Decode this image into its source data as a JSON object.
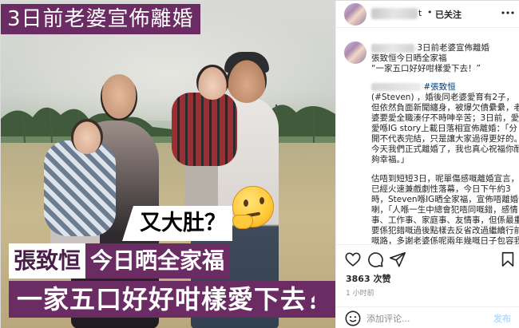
{
  "image": {
    "headline": "3日前老婆宣佈離婚",
    "question": "又大肚？",
    "emoji_icon": "thinking-face-emoji",
    "caption_name": "張致恒",
    "caption_highlight": "今日晒全家福",
    "caption_line2": "一家五口好好咁樣愛下去！",
    "quote_mark": "”",
    "colors": {
      "banner": "#6b2b63",
      "highlight_text": "#ffffff"
    }
  },
  "header": {
    "username_visible_tail": "t",
    "separator": "•",
    "follow_label": "已关注",
    "more_icon": "more-options-icon"
  },
  "caption": {
    "title_text": "3日前老婆宣佈離婚",
    "line2": "張致恒今日晒全家福",
    "line3": "“一家五口好好咁樣愛下去！”",
    "hashtag": "#張致恒",
    "body_lines": [
      "(#Steven) ，婚後同老婆愛育有2子，",
      "但依然負面新聞纏身，被爆欠債纍纍，老",
      "婆要愛全職湊仔不時呻辛苦；3日前，愛",
      "愛喺IG story上載日落相宣佈離婚：「分",
      "開不代表完結，只是讓大家過得更好的。",
      "今天我們正式離婚了，我也真心祝福你耐",
      "夠幸福。」"
    ],
    "body2_lines": [
      "估唔到短短3日，呢單傷感嘅離婚宣言，",
      "已經火速兼戲劇性落幕，今日下午約3",
      "時，Steven喺IG晒全家福，宣佈唔離婚",
      "喇，「人喺一生中總會犯唔同嘅錯，感情",
      "事、工作事、家庭事、友情事，但係最重",
      "要係犯錯嘅過後點樣去反省改過繼續行前面",
      "嘅路，多謝老婆係呢兩年幾嘅日子包容我"
    ]
  },
  "actions": {
    "like_icon": "heart-icon",
    "comment_icon": "comment-icon",
    "share_icon": "share-icon",
    "save_icon": "bookmark-icon"
  },
  "stats": {
    "likes": "3863 次赞",
    "timestamp": "1 小时前"
  },
  "comment_box": {
    "emoji_icon": "smiley-icon",
    "placeholder": "添加评论...",
    "post_label": "发布"
  }
}
